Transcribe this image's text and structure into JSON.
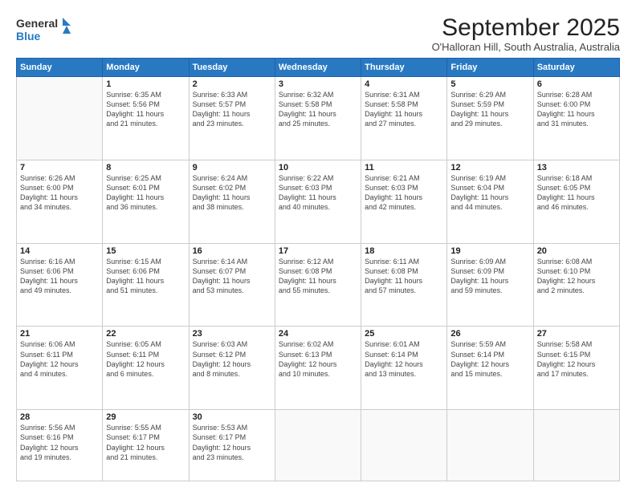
{
  "logo": {
    "general": "General",
    "blue": "Blue"
  },
  "header": {
    "month": "September 2025",
    "location": "O'Halloran Hill, South Australia, Australia"
  },
  "weekdays": [
    "Sunday",
    "Monday",
    "Tuesday",
    "Wednesday",
    "Thursday",
    "Friday",
    "Saturday"
  ],
  "weeks": [
    [
      {
        "day": "",
        "info": ""
      },
      {
        "day": "1",
        "info": "Sunrise: 6:35 AM\nSunset: 5:56 PM\nDaylight: 11 hours\nand 21 minutes."
      },
      {
        "day": "2",
        "info": "Sunrise: 6:33 AM\nSunset: 5:57 PM\nDaylight: 11 hours\nand 23 minutes."
      },
      {
        "day": "3",
        "info": "Sunrise: 6:32 AM\nSunset: 5:58 PM\nDaylight: 11 hours\nand 25 minutes."
      },
      {
        "day": "4",
        "info": "Sunrise: 6:31 AM\nSunset: 5:58 PM\nDaylight: 11 hours\nand 27 minutes."
      },
      {
        "day": "5",
        "info": "Sunrise: 6:29 AM\nSunset: 5:59 PM\nDaylight: 11 hours\nand 29 minutes."
      },
      {
        "day": "6",
        "info": "Sunrise: 6:28 AM\nSunset: 6:00 PM\nDaylight: 11 hours\nand 31 minutes."
      }
    ],
    [
      {
        "day": "7",
        "info": "Sunrise: 6:26 AM\nSunset: 6:00 PM\nDaylight: 11 hours\nand 34 minutes."
      },
      {
        "day": "8",
        "info": "Sunrise: 6:25 AM\nSunset: 6:01 PM\nDaylight: 11 hours\nand 36 minutes."
      },
      {
        "day": "9",
        "info": "Sunrise: 6:24 AM\nSunset: 6:02 PM\nDaylight: 11 hours\nand 38 minutes."
      },
      {
        "day": "10",
        "info": "Sunrise: 6:22 AM\nSunset: 6:03 PM\nDaylight: 11 hours\nand 40 minutes."
      },
      {
        "day": "11",
        "info": "Sunrise: 6:21 AM\nSunset: 6:03 PM\nDaylight: 11 hours\nand 42 minutes."
      },
      {
        "day": "12",
        "info": "Sunrise: 6:19 AM\nSunset: 6:04 PM\nDaylight: 11 hours\nand 44 minutes."
      },
      {
        "day": "13",
        "info": "Sunrise: 6:18 AM\nSunset: 6:05 PM\nDaylight: 11 hours\nand 46 minutes."
      }
    ],
    [
      {
        "day": "14",
        "info": "Sunrise: 6:16 AM\nSunset: 6:06 PM\nDaylight: 11 hours\nand 49 minutes."
      },
      {
        "day": "15",
        "info": "Sunrise: 6:15 AM\nSunset: 6:06 PM\nDaylight: 11 hours\nand 51 minutes."
      },
      {
        "day": "16",
        "info": "Sunrise: 6:14 AM\nSunset: 6:07 PM\nDaylight: 11 hours\nand 53 minutes."
      },
      {
        "day": "17",
        "info": "Sunrise: 6:12 AM\nSunset: 6:08 PM\nDaylight: 11 hours\nand 55 minutes."
      },
      {
        "day": "18",
        "info": "Sunrise: 6:11 AM\nSunset: 6:08 PM\nDaylight: 11 hours\nand 57 minutes."
      },
      {
        "day": "19",
        "info": "Sunrise: 6:09 AM\nSunset: 6:09 PM\nDaylight: 11 hours\nand 59 minutes."
      },
      {
        "day": "20",
        "info": "Sunrise: 6:08 AM\nSunset: 6:10 PM\nDaylight: 12 hours\nand 2 minutes."
      }
    ],
    [
      {
        "day": "21",
        "info": "Sunrise: 6:06 AM\nSunset: 6:11 PM\nDaylight: 12 hours\nand 4 minutes."
      },
      {
        "day": "22",
        "info": "Sunrise: 6:05 AM\nSunset: 6:11 PM\nDaylight: 12 hours\nand 6 minutes."
      },
      {
        "day": "23",
        "info": "Sunrise: 6:03 AM\nSunset: 6:12 PM\nDaylight: 12 hours\nand 8 minutes."
      },
      {
        "day": "24",
        "info": "Sunrise: 6:02 AM\nSunset: 6:13 PM\nDaylight: 12 hours\nand 10 minutes."
      },
      {
        "day": "25",
        "info": "Sunrise: 6:01 AM\nSunset: 6:14 PM\nDaylight: 12 hours\nand 13 minutes."
      },
      {
        "day": "26",
        "info": "Sunrise: 5:59 AM\nSunset: 6:14 PM\nDaylight: 12 hours\nand 15 minutes."
      },
      {
        "day": "27",
        "info": "Sunrise: 5:58 AM\nSunset: 6:15 PM\nDaylight: 12 hours\nand 17 minutes."
      }
    ],
    [
      {
        "day": "28",
        "info": "Sunrise: 5:56 AM\nSunset: 6:16 PM\nDaylight: 12 hours\nand 19 minutes."
      },
      {
        "day": "29",
        "info": "Sunrise: 5:55 AM\nSunset: 6:17 PM\nDaylight: 12 hours\nand 21 minutes."
      },
      {
        "day": "30",
        "info": "Sunrise: 5:53 AM\nSunset: 6:17 PM\nDaylight: 12 hours\nand 23 minutes."
      },
      {
        "day": "",
        "info": ""
      },
      {
        "day": "",
        "info": ""
      },
      {
        "day": "",
        "info": ""
      },
      {
        "day": "",
        "info": ""
      }
    ]
  ]
}
